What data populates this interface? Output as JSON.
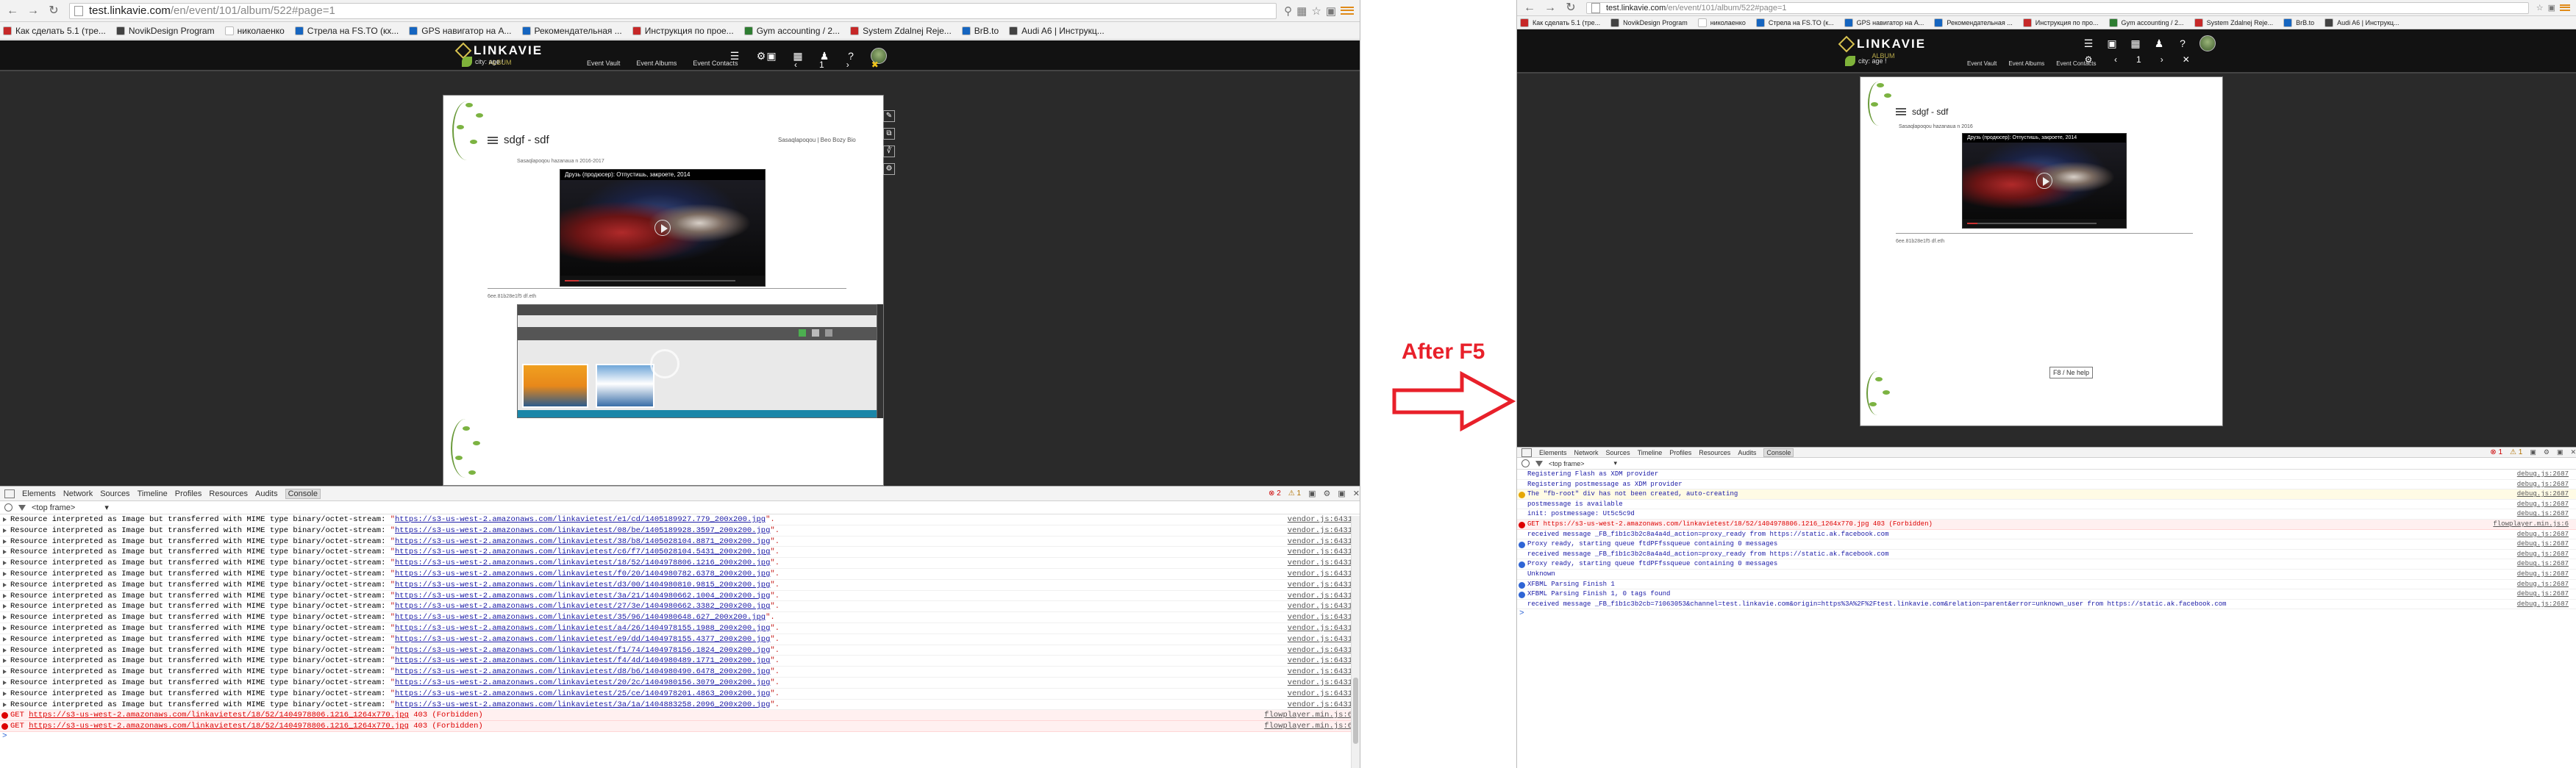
{
  "colors": {
    "accent_red": "#e8202a",
    "error_red": "#cc0000",
    "link_blue": "#1a1aa6",
    "logo_gold": "#d7c24f",
    "leaf_green": "#7cb342",
    "site_header": "#121212"
  },
  "annotation": {
    "label": "After F5",
    "arrow_icon": "right-arrow-outline"
  },
  "left": {
    "url": {
      "host": "test.linkavie.com",
      "path": "/en/event/101/album/522#page=1"
    },
    "bookmarks": [
      {
        "label": "Как сделать 5.1 (тре...",
        "fav": "#c62828"
      },
      {
        "label": "NovikDesign Program",
        "fav": "#424242"
      },
      {
        "label": "николаенко",
        "fav": "#ffffff"
      },
      {
        "label": "Стрела на FS.TO (кх...",
        "fav": "#1565c0"
      },
      {
        "label": "GPS навигатор на A...",
        "fav": "#1565c0"
      },
      {
        "label": "Рекомендательная ...",
        "fav": "#1565c0"
      },
      {
        "label": "Инструкция по прое...",
        "fav": "#c62828"
      },
      {
        "label": "Gym accounting / 2...",
        "fav": "#2e7d32"
      },
      {
        "label": "System Zdalnej Reje...",
        "fav": "#c62828"
      },
      {
        "label": "BrB.to",
        "fav": "#1565c0"
      },
      {
        "label": "Audi A6 | Инструкц...",
        "fav": "#424242"
      }
    ],
    "site": {
      "brand": "LINKAVIE",
      "tagline": "ALBUM",
      "city": "city: age !",
      "nav": [
        "Event Vault",
        "Event Albums",
        "Event Contacts"
      ],
      "page_num": "1"
    },
    "album": {
      "title": "sdgf - sdf",
      "meta": "Sasaqlapoqou | Beo Bozy Bio",
      "small": "Sasaqlapoqou hazanaua n 2016-2017",
      "video_title": "Друзь (продюсер): Отпустишь, закроете, 2014",
      "caption": "6ee.81b28e1f5 df.eth"
    },
    "devtools": {
      "tabs": [
        "Elements",
        "Network",
        "Sources",
        "Timeline",
        "Profiles",
        "Resources",
        "Audits",
        "Console"
      ],
      "active_tab": "Console",
      "error_count": "2",
      "warn_count": "1",
      "frame": "<top frame>",
      "log_prefix": "Resource interpreted as Image but transferred with MIME type binary/octet-stream: ",
      "log_rows": [
        {
          "url": "https://s3-us-west-2.amazonaws.com/linkavietest/e1/cd/1405189927.779_200x200.jpg",
          "src": "vendor.js:6431"
        },
        {
          "url": "https://s3-us-west-2.amazonaws.com/linkavietest/08/be/1405189928.3597_200x200.jpg",
          "src": "vendor.js:6431"
        },
        {
          "url": "https://s3-us-west-2.amazonaws.com/linkavietest/38/b8/1405028104.8871_200x200.jpg",
          "src": "vendor.js:6431"
        },
        {
          "url": "https://s3-us-west-2.amazonaws.com/linkavietest/c6/f7/1405028104.5431_200x200.jpg",
          "src": "vendor.js:6431"
        },
        {
          "url": "https://s3-us-west-2.amazonaws.com/linkavietest/18/52/1404978806.1216_200x200.jpg",
          "src": "vendor.js:6431"
        },
        {
          "url": "https://s3-us-west-2.amazonaws.com/linkavietest/f0/20/1404980782.6378_200x200.jpg",
          "src": "vendor.js:6431"
        },
        {
          "url": "https://s3-us-west-2.amazonaws.com/linkavietest/d3/00/1404980810.9815_200x200.jpg",
          "src": "vendor.js:6431"
        },
        {
          "url": "https://s3-us-west-2.amazonaws.com/linkavietest/3a/21/1404980662.1004_200x200.jpg",
          "src": "vendor.js:6431"
        },
        {
          "url": "https://s3-us-west-2.amazonaws.com/linkavietest/27/3e/1404980662.3382_200x200.jpg",
          "src": "vendor.js:6431"
        },
        {
          "url": "https://s3-us-west-2.amazonaws.com/linkavietest/35/96/1404980648.627_200x200.jpg",
          "src": "vendor.js:6431"
        },
        {
          "url": "https://s3-us-west-2.amazonaws.com/linkavietest/a4/26/1404978155.1988_200x200.jpg",
          "src": "vendor.js:6431"
        },
        {
          "url": "https://s3-us-west-2.amazonaws.com/linkavietest/e9/dd/1404978155.4377_200x200.jpg",
          "src": "vendor.js:6431"
        },
        {
          "url": "https://s3-us-west-2.amazonaws.com/linkavietest/f1/74/1404978156.1824_200x200.jpg",
          "src": "vendor.js:6431"
        },
        {
          "url": "https://s3-us-west-2.amazonaws.com/linkavietest/f4/4d/1404980489.1771_200x200.jpg",
          "src": "vendor.js:6431"
        },
        {
          "url": "https://s3-us-west-2.amazonaws.com/linkavietest/d8/b6/1404980490.6478_200x200.jpg",
          "src": "vendor.js:6431"
        },
        {
          "url": "https://s3-us-west-2.amazonaws.com/linkavietest/20/2c/1404980156.3079_200x200.jpg",
          "src": "vendor.js:6431"
        },
        {
          "url": "https://s3-us-west-2.amazonaws.com/linkavietest/25/ce/1404978201.4863_200x200.jpg",
          "src": "vendor.js:6431"
        },
        {
          "url": "https://s3-us-west-2.amazonaws.com/linkavietest/3a/1a/1404883258.2096_200x200.jpg",
          "src": "vendor.js:6431"
        }
      ],
      "error_rows": [
        {
          "method": "GET",
          "url": "https://s3-us-west-2.amazonaws.com/linkavietest/18/52/1404978806.1216_1264x770.jpg",
          "status": "403 (Forbidden)",
          "src": "flowplayer.min.js:6"
        },
        {
          "method": "GET",
          "url": "https://s3-us-west-2.amazonaws.com/linkavietest/18/52/1404978806.1216_1264x770.jpg",
          "status": "403 (Forbidden)",
          "src": "flowplayer.min.js:6"
        }
      ]
    }
  },
  "right": {
    "url": {
      "host": "test.linkavie.com",
      "path": "/en/event/101/album/522#page=1"
    },
    "bookmarks": [
      {
        "label": "Как сделать 5.1 (тре...",
        "fav": "#c62828"
      },
      {
        "label": "NovikDesign Program",
        "fav": "#424242"
      },
      {
        "label": "николаенко",
        "fav": "#ffffff"
      },
      {
        "label": "Стрела на FS.TO (к...",
        "fav": "#1565c0"
      },
      {
        "label": "GPS навигатор на A...",
        "fav": "#1565c0"
      },
      {
        "label": "Рекомендательная ...",
        "fav": "#1565c0"
      },
      {
        "label": "Инструкция по про...",
        "fav": "#c62828"
      },
      {
        "label": "Gym accounting / 2...",
        "fav": "#2e7d32"
      },
      {
        "label": "System Zdalnej Reje...",
        "fav": "#c62828"
      },
      {
        "label": "BrB.to",
        "fav": "#1565c0"
      },
      {
        "label": "Audi A6 | Инструкц...",
        "fav": "#424242"
      }
    ],
    "site": {
      "brand": "LINKAVIE",
      "tagline": "ALBUM",
      "city": "city: age !",
      "nav": [
        "Event Vault",
        "Event Albums",
        "Event Contacts"
      ],
      "page_num": "1"
    },
    "album": {
      "title": "sdgf - sdf",
      "meta": "Sasaqlapoqou hazanaua n 2016",
      "video_title": "Друзь (продюсер): Отпустишь, закроете, 2014",
      "caption": "6ee.81b28e1f5 df.eth",
      "tooltip": "F8 / Ne help"
    },
    "devtools": {
      "tabs": [
        "Elements",
        "Network",
        "Sources",
        "Timeline",
        "Profiles",
        "Resources",
        "Audits",
        "Console"
      ],
      "active_tab": "Console",
      "error_count": "1",
      "warn_count": "1",
      "frame": "<top frame>",
      "log_rows": [
        {
          "kind": "log",
          "text": "Registering Flash as XDM provider",
          "src": "debug.js:2687"
        },
        {
          "kind": "log",
          "text": "Registering postmessage as XDM provider",
          "src": "debug.js:2687"
        },
        {
          "kind": "warn",
          "text": "The \"fb-root\" div has not been created, auto-creating",
          "src": "debug.js:2687"
        },
        {
          "kind": "log",
          "text": "postmessage is available",
          "src": "debug.js:2687"
        },
        {
          "kind": "log",
          "text": "init: postmessage: Ut5c5c9d",
          "src": "debug.js:2687"
        },
        {
          "kind": "error",
          "text": "GET https://s3-us-west-2.amazonaws.com/linkavietest/18/52/1404978806.1216_1264x770.jpg 403 (Forbidden)",
          "src": "flowplayer.min.js:6"
        },
        {
          "kind": "log",
          "text": "received message _FB_f1b1c3b2c8a4a4d_action=proxy_ready from https://static.ak.facebook.com",
          "src": "debug.js:2687"
        },
        {
          "kind": "info",
          "text": "Proxy ready, starting queue ftdPFfssqueue containing 0 messages",
          "src": "debug.js:2687"
        },
        {
          "kind": "log",
          "text": "received message _FB_f1b1c3b2c8a4a4d_action=proxy_ready from https://static.ak.facebook.com",
          "src": "debug.js:2687"
        },
        {
          "kind": "info",
          "text": "Proxy ready, starting queue ftdPFfssqueue containing 0 messages",
          "src": "debug.js:2687"
        },
        {
          "kind": "log",
          "text": "Unknown",
          "src": "debug.js:2687"
        },
        {
          "kind": "info",
          "text": "XFBML Parsing Finish 1",
          "src": "debug.js:2687"
        },
        {
          "kind": "info",
          "text": "XFBML Parsing Finish 1, 0 tags found",
          "src": "debug.js:2687"
        },
        {
          "kind": "log",
          "text": "received message _FB_f1b1c3b2cb=71063053&channel=test.linkavie.com&origin=https%3A%2F%2Ftest.linkavie.com&relation=parent&error=unknown_user from https://static.ak.facebook.com",
          "src": "debug.js:2687"
        }
      ]
    }
  }
}
